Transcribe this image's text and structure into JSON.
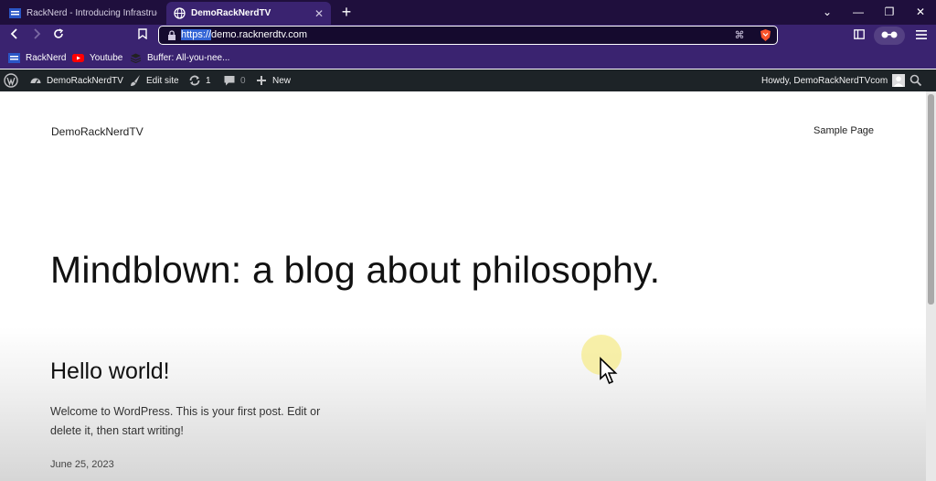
{
  "tabs": [
    {
      "label": "RackNerd - Introducing Infrastructure",
      "close": "✕"
    },
    {
      "label": "DemoRackNerdTV",
      "close": "✕"
    }
  ],
  "newtab_label": "+",
  "window_controls": {
    "dropdown": "⌄",
    "minimize": "—",
    "restore": "❐",
    "close": "✕"
  },
  "address": {
    "protocol": "https://",
    "rest": "demo.racknerdtv.com"
  },
  "bookmarks": [
    {
      "label": "RackNerd"
    },
    {
      "label": "Youtube"
    },
    {
      "label": "Buffer: All-you-nee..."
    }
  ],
  "adminbar": {
    "site_name": "DemoRackNerdTV",
    "edit_site": "Edit site",
    "updates_count": "1",
    "comments_count": "0",
    "new_label": "New",
    "howdy": "Howdy, DemoRackNerdTVcom"
  },
  "page": {
    "site_title": "DemoRackNerdTV",
    "nav_link": "Sample Page",
    "headline": "Mindblown: a blog about philosophy.",
    "post_title": "Hello world!",
    "post_excerpt": "Welcome to WordPress. This is your first post. Edit or delete it, then start writing!",
    "post_date": "June 25, 2023"
  },
  "colors": {
    "tabbar_bg": "#1f0f3d",
    "toolbar_bg": "#3a2370",
    "adminbar_bg": "#1d2327",
    "selection": "#3466d6",
    "brave_orange": "#fb542b"
  }
}
